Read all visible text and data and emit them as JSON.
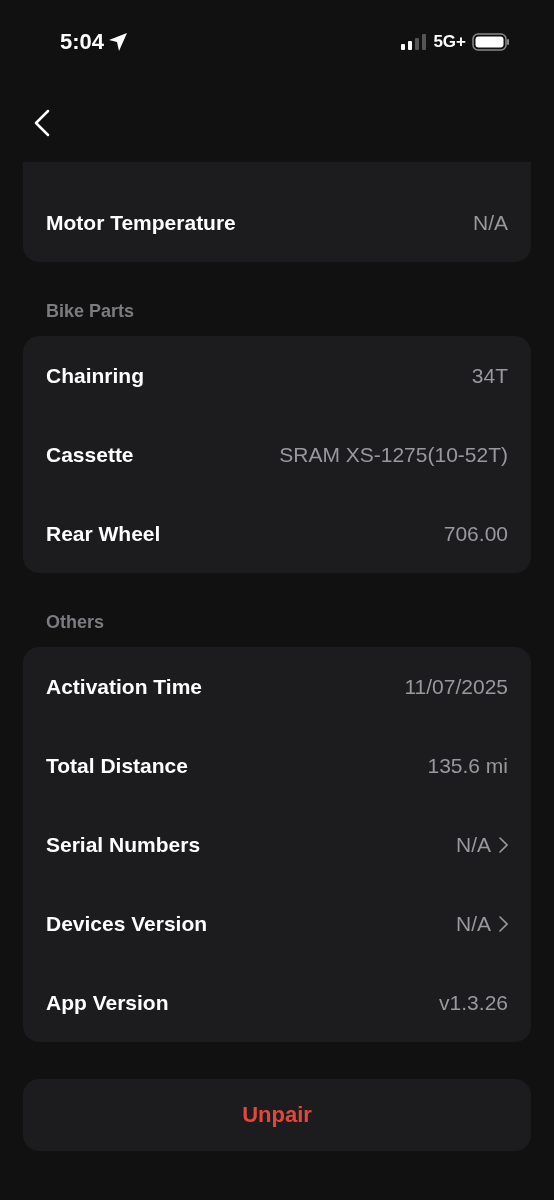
{
  "status_bar": {
    "time": "5:04",
    "network": "5G+"
  },
  "sections": [
    {
      "cut_top": true,
      "rows": [
        {
          "label": "Motor Temperature",
          "value": "N/A",
          "kind": "plain"
        }
      ]
    },
    {
      "title": "Bike Parts",
      "cut_top": false,
      "rows": [
        {
          "label": "Chainring",
          "value": "34T",
          "kind": "plain"
        },
        {
          "label": "Cassette",
          "value": "SRAM XS-1275(10-52T)",
          "kind": "plain"
        },
        {
          "label": "Rear Wheel",
          "value": "706.00",
          "kind": "plain"
        }
      ]
    },
    {
      "title": "Others",
      "cut_top": false,
      "rows": [
        {
          "label": "Activation Time",
          "value": "11/07/2025",
          "kind": "plain"
        },
        {
          "label": "Total Distance",
          "value": "135.6 mi",
          "kind": "plain"
        },
        {
          "label": "Serial Numbers",
          "value": "N/A",
          "kind": "link"
        },
        {
          "label": "Devices Version",
          "value": "N/A",
          "kind": "link"
        },
        {
          "label": "App Version",
          "value": "v1.3.26",
          "kind": "plain"
        }
      ]
    }
  ],
  "unpair_button": "Unpair"
}
